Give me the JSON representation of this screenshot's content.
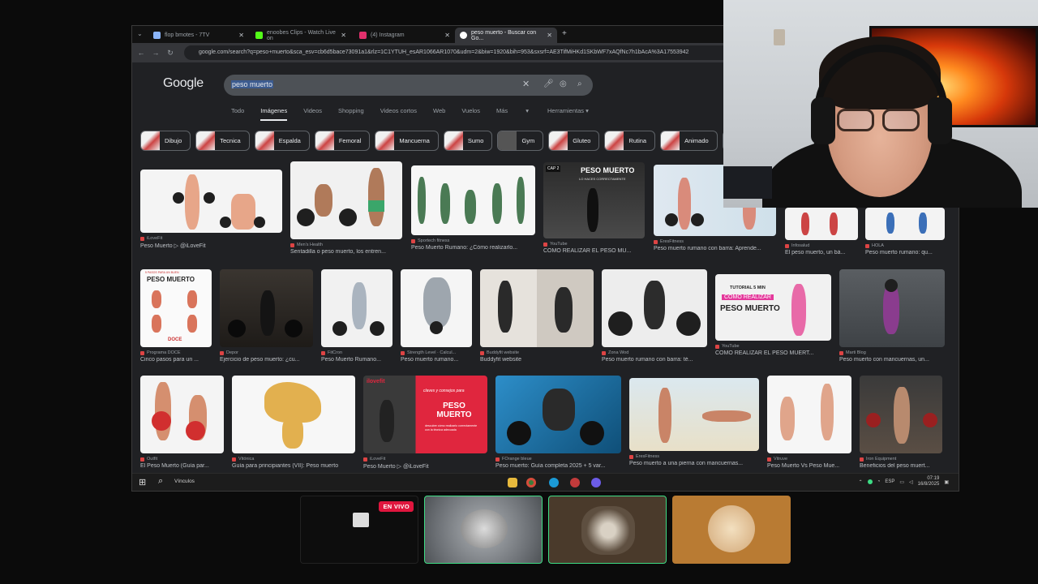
{
  "browser": {
    "tabs": [
      {
        "label": "flop bmotes - 7TV",
        "color": "#9aa0a6"
      },
      {
        "label": "enoobes Clips - Watch Live on",
        "color": "#53fc18"
      },
      {
        "label": "(4) Instagram",
        "color": "#e1306c"
      },
      {
        "label": "peso muerto - Buscar con Go...",
        "color": "#dfe1e5"
      }
    ],
    "url": "google.com/search?q=peso+muerto&sca_esv=cb6d5bace73091a1&rlz=1C1YTUH_esAR1066AR1070&udm=2&biw=1920&bih=953&sxsrf=AE3TifMiHKd1SKbWF7xAQfNc7h1bAcA%3A17553942"
  },
  "google": {
    "logo": "Google",
    "query": "peso muerto",
    "filters": [
      "Todo",
      "Imágenes",
      "Videos",
      "Shopping",
      "Videos cortos",
      "Web",
      "Vuelos",
      "Más"
    ],
    "tools": "Herramientas",
    "chips": [
      "Dibujo",
      "Tecnica",
      "Espalda",
      "Femoral",
      "Mancuerna",
      "Sumo",
      "Gym",
      "Gluteo",
      "Rutina",
      "Animado"
    ]
  },
  "results": [
    {
      "src": "iLoveFit",
      "cap": "Peso Muerto ▷ @iLoveFit"
    },
    {
      "src": "Men's Health",
      "cap": "Sentadilla o peso muerto, los entren..."
    },
    {
      "src": "Sportech fitness",
      "cap": "Peso Muerto Rumano: ¿Cómo realizarlo..."
    },
    {
      "src": "YouTube",
      "cap": "COMO REALIZAR EL PESO MU..."
    },
    {
      "src": "EresFitness",
      "cap": "Peso muerto rumano con barra: Aprende..."
    },
    {
      "src": "Infosalud",
      "cap": "El peso muerto, un bá..."
    },
    {
      "src": "HOLA",
      "cap": "Peso muerto rumano: qu..."
    },
    {
      "src": "Programa DOCE",
      "cap": "Cinco pasos para un ..."
    },
    {
      "src": "Depor",
      "cap": "Ejercicio de peso muerto: ¿cu..."
    },
    {
      "src": "FitCron",
      "cap": "Peso Muerto Rumano..."
    },
    {
      "src": "Strength Level · Calcul...",
      "cap": "Peso muerto rumano..."
    },
    {
      "src": "Buddyfit website",
      "cap": "Buddyfit website"
    },
    {
      "src": "Zona Wod",
      "cap": "Peso muerto rumano con barra: té..."
    },
    {
      "src": "YouTube",
      "cap": "COMO REALIZAR EL PESO MUERT..."
    },
    {
      "src": "Marti Blog",
      "cap": "Peso muerto con mancuernas, un..."
    },
    {
      "src": "Outfit",
      "cap": "El Peso Muerto (Guía par..."
    },
    {
      "src": "Vitónica",
      "cap": "Guía para principiantes (VII): Peso muerto"
    },
    {
      "src": "iLoveFit",
      "cap": "Peso Muerto ▷ @iLoveFit"
    },
    {
      "src": "FOrange bleue",
      "cap": "Peso muerto: Guía completa 2025 + 5 var..."
    },
    {
      "src": "EresFitness",
      "cap": "Peso muerto a una pierna con mancuernas..."
    },
    {
      "src": "Vitruve",
      "cap": "Peso Muerto Vs Peso Mue..."
    },
    {
      "src": "Iron Equipment",
      "cap": "Beneficios del peso muert..."
    }
  ],
  "overlays": {
    "r4_title": "PESO MUERTO",
    "r4_sub": "LO HACES CORRECTAMENTE",
    "r4_badge": "CAP 2",
    "r8_title": "PESO MUERTO",
    "r8_top": "5 PASOS PARA UN BUEN",
    "r8_bottom": "DOCE",
    "r14_small": "TUTORIAL 5 MIN",
    "r14_pink": "COMO REALIZAR",
    "r14_title": "PESO MUERTO",
    "r20_brand": "ilovefit",
    "r20_script": "claves y consejos para",
    "r20_title": "PESO MUERTO",
    "r20_body": "descubre cómo realizarlo correctamente con la técnica adecuada"
  },
  "taskbar": {
    "search_label": "Vínculos",
    "lang": "ESP",
    "time": "07:19",
    "date": "16/8/2025"
  },
  "stream": {
    "live_label": "EN VIVO"
  },
  "colors": {
    "accent_live": "#e0163e",
    "tile_green_border": "#3ddc84"
  }
}
